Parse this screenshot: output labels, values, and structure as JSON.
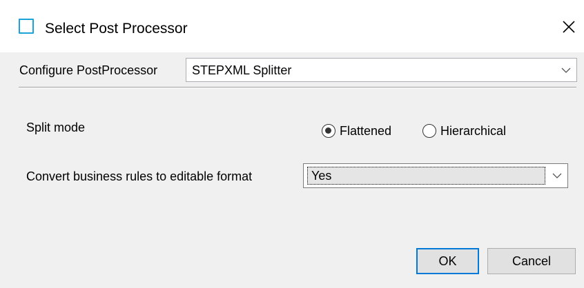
{
  "window": {
    "title": "Select Post Processor"
  },
  "icons": {
    "title": "window-icon",
    "close": "close-icon",
    "chevron": "chevron-down-icon"
  },
  "postprocessor": {
    "label": "Configure PostProcessor",
    "selected": "STEPXML Splitter"
  },
  "split_mode": {
    "label": "Split mode",
    "options": [
      {
        "label": "Flattened",
        "checked": true
      },
      {
        "label": "Hierarchical",
        "checked": false
      }
    ]
  },
  "business_rules": {
    "label": "Convert business rules to editable format",
    "selected": "Yes"
  },
  "buttons": {
    "ok": "OK",
    "cancel": "Cancel"
  },
  "colors": {
    "accent": "#0078d7",
    "title_icon": "#1aa3d9"
  }
}
